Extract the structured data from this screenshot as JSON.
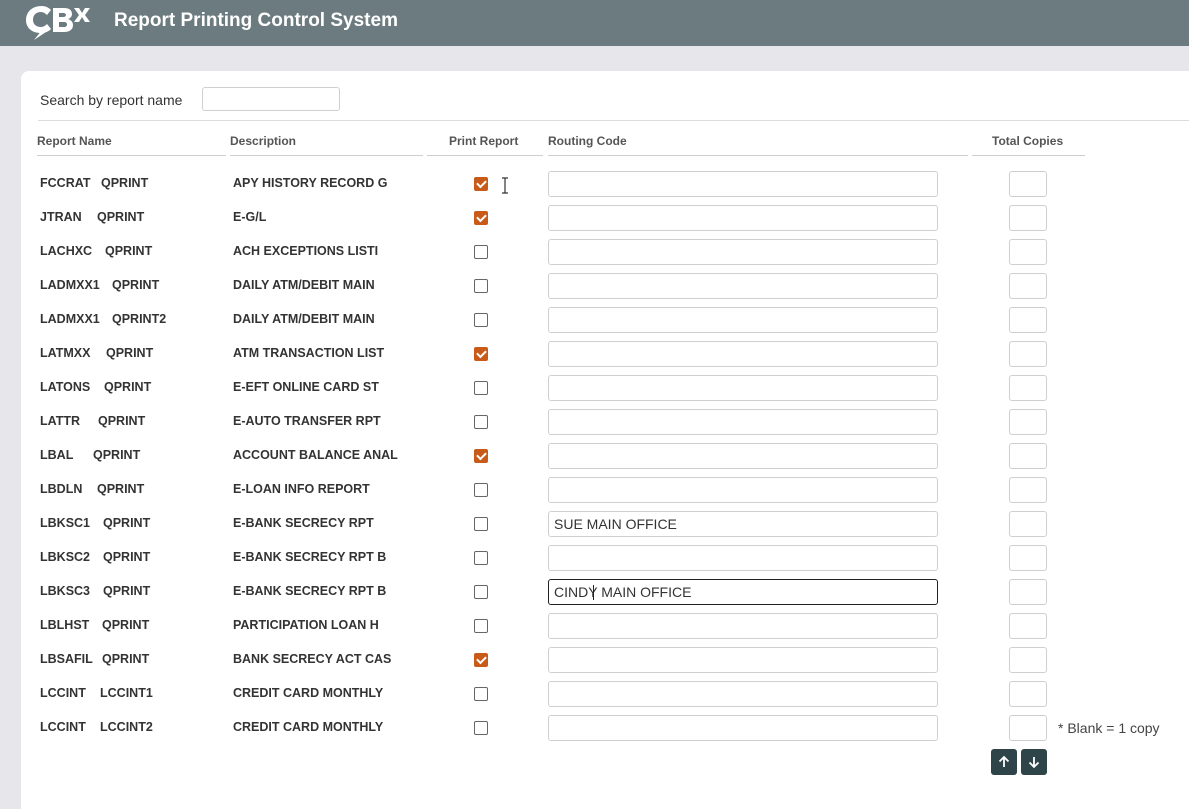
{
  "header": {
    "title": "Report Printing Control System",
    "logo_icon": "cbx-logo-icon"
  },
  "search": {
    "label": "Search by report name",
    "value": "",
    "placeholder": ""
  },
  "columns": {
    "report_name": "Report Name",
    "description": "Description",
    "print_report": "Print Report",
    "routing_code": "Routing Code",
    "total_copies": "Total Copies"
  },
  "rows": [
    {
      "name": "FCCRAT",
      "queue": "QPRINT",
      "description": "APY HISTORY RECORD G",
      "print": true,
      "routing": "",
      "copies": ""
    },
    {
      "name": "JTRAN",
      "queue": "QPRINT",
      "description": "E-G/L",
      "print": true,
      "routing": "",
      "copies": ""
    },
    {
      "name": "LACHXC",
      "queue": "QPRINT",
      "description": "ACH EXCEPTIONS LISTI",
      "print": false,
      "routing": "",
      "copies": ""
    },
    {
      "name": "LADMXX1",
      "queue": "QPRINT",
      "description": "DAILY ATM/DEBIT MAIN",
      "print": false,
      "routing": "",
      "copies": ""
    },
    {
      "name": "LADMXX1",
      "queue": "QPRINT2",
      "description": "DAILY ATM/DEBIT MAIN",
      "print": false,
      "routing": "",
      "copies": ""
    },
    {
      "name": "LATMXX",
      "queue": "QPRINT",
      "description": "ATM TRANSACTION LIST",
      "print": true,
      "routing": "",
      "copies": ""
    },
    {
      "name": "LATONS",
      "queue": "QPRINT",
      "description": "E-EFT ONLINE CARD ST",
      "print": false,
      "routing": "",
      "copies": ""
    },
    {
      "name": "LATTR",
      "queue": "QPRINT",
      "description": "E-AUTO TRANSFER RPT",
      "print": false,
      "routing": "",
      "copies": ""
    },
    {
      "name": "LBAL",
      "queue": "QPRINT",
      "description": "ACCOUNT BALANCE ANAL",
      "print": true,
      "routing": "",
      "copies": ""
    },
    {
      "name": "LBDLN",
      "queue": "QPRINT",
      "description": "E-LOAN INFO REPORT",
      "print": false,
      "routing": "",
      "copies": ""
    },
    {
      "name": "LBKSC1",
      "queue": "QPRINT",
      "description": "E-BANK SECRECY RPT",
      "print": false,
      "routing": "SUE MAIN OFFICE",
      "copies": ""
    },
    {
      "name": "LBKSC2",
      "queue": "QPRINT",
      "description": "E-BANK SECRECY RPT B",
      "print": false,
      "routing": "",
      "copies": ""
    },
    {
      "name": "LBKSC3",
      "queue": "QPRINT",
      "description": "E-BANK SECRECY RPT B",
      "print": false,
      "routing": "CINDY MAIN OFFICE",
      "copies": "",
      "focused": true
    },
    {
      "name": "LBLHST",
      "queue": "QPRINT",
      "description": "PARTICIPATION LOAN H",
      "print": false,
      "routing": "",
      "copies": ""
    },
    {
      "name": "LBSAFIL",
      "queue": "QPRINT",
      "description": "BANK SECRECY ACT CAS",
      "print": true,
      "routing": "",
      "copies": ""
    },
    {
      "name": "LCCINT",
      "queue": "LCCINT1",
      "description": "CREDIT CARD MONTHLY",
      "print": false,
      "routing": "",
      "copies": ""
    },
    {
      "name": "LCCINT",
      "queue": "LCCINT2",
      "description": "CREDIT CARD MONTHLY",
      "print": false,
      "routing": "",
      "copies": ""
    }
  ],
  "footer": {
    "note": "* Blank = 1 copy",
    "up_icon": "arrow-up-icon",
    "down_icon": "arrow-down-icon"
  },
  "colors": {
    "header_bg": "#6c7b80",
    "checkbox_checked": "#c85a1a",
    "nav_button": "#2f4448",
    "page_bg": "#e6e6eb"
  }
}
